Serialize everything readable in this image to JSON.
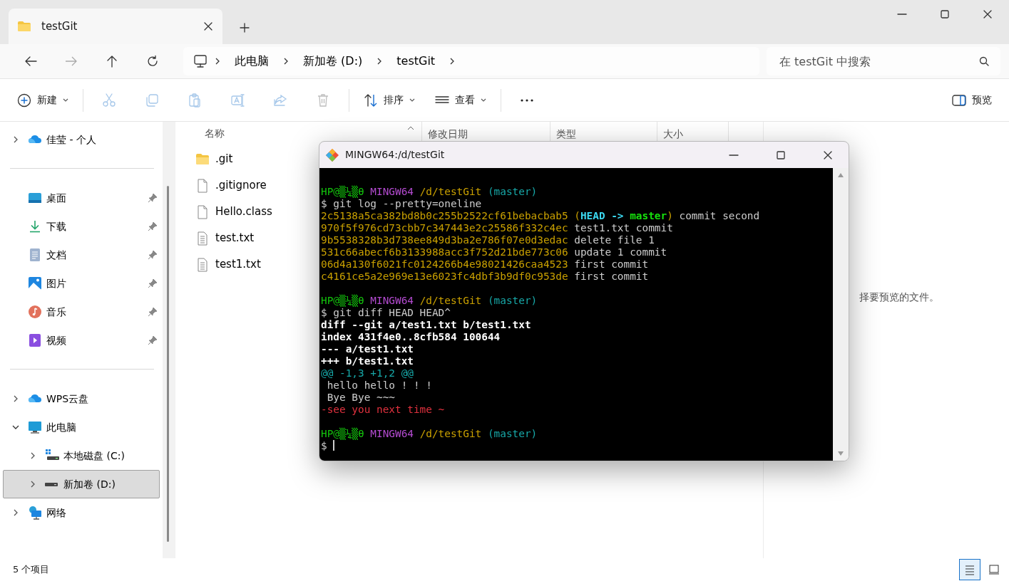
{
  "explorer": {
    "tabs": [
      {
        "title": "testGit",
        "selected": true
      }
    ],
    "address": {
      "crumbs": [
        "此电脑",
        "新加卷 (D:)",
        "testGit"
      ]
    },
    "search": {
      "placeholder": "在 testGit 中搜索"
    },
    "toolbar": [
      {
        "kind": "new",
        "label": "新建",
        "dropdown": true,
        "disabled": false
      },
      {
        "kind": "cut",
        "disabled": true
      },
      {
        "kind": "copy",
        "disabled": true
      },
      {
        "kind": "paste",
        "disabled": true
      },
      {
        "kind": "rename",
        "disabled": true
      },
      {
        "kind": "share",
        "disabled": true
      },
      {
        "kind": "delete",
        "disabled": true
      },
      {
        "kind": "sort",
        "label": "排序",
        "dropdown": true,
        "disabled": false
      },
      {
        "kind": "view",
        "label": "查看",
        "dropdown": true,
        "disabled": false
      },
      {
        "kind": "more"
      }
    ],
    "preview_button": {
      "label": "预览"
    },
    "sidebar": [
      [
        {
          "label": "佳莹 - 个人",
          "kind": "cloud",
          "expanded": false,
          "selected": false
        }
      ],
      [
        {
          "label": "桌面",
          "kind": "desktop",
          "pinned": true,
          "selected": false
        },
        {
          "label": "下载",
          "kind": "download",
          "pinned": true,
          "selected": false
        },
        {
          "label": "文档",
          "kind": "document",
          "pinned": true,
          "selected": false
        },
        {
          "label": "图片",
          "kind": "pictures",
          "pinned": true,
          "selected": false
        },
        {
          "label": "音乐",
          "kind": "music",
          "pinned": true,
          "selected": false
        },
        {
          "label": "视频",
          "kind": "video",
          "pinned": true,
          "selected": false
        }
      ],
      [
        {
          "label": "WPS云盘",
          "kind": "cloud",
          "expanded": false,
          "selected": false
        },
        {
          "label": "此电脑",
          "kind": "pc",
          "expanded": true,
          "selected": false,
          "children": [
            {
              "label": "本地磁盘 (C:)",
              "kind": "system-drive",
              "expanded": false,
              "selected": false
            },
            {
              "label": "新加卷 (D:)",
              "kind": "drive",
              "expanded": false,
              "selected": true
            }
          ]
        },
        {
          "label": "网络",
          "kind": "network",
          "expanded": false,
          "selected": false
        }
      ]
    ],
    "columns": [
      "名称",
      "修改日期",
      "类型",
      "大小"
    ],
    "files": [
      {
        "name": ".git",
        "kind": "folder"
      },
      {
        "name": ".gitignore",
        "kind": "file"
      },
      {
        "name": "Hello.class",
        "kind": "file"
      },
      {
        "name": "test.txt",
        "kind": "text"
      },
      {
        "name": "test1.txt",
        "kind": "text"
      }
    ],
    "preview_message": "择要预览的文件。",
    "status": "5 个项目",
    "view_modes": [
      {
        "kind": "details",
        "selected": true
      },
      {
        "kind": "tiles",
        "selected": false
      }
    ]
  },
  "terminal": {
    "title": "MINGW64:/d/testGit",
    "lines": [
      {
        "kind": "blank"
      },
      {
        "segments": [
          {
            "text": "HP@▒¼▒θ ",
            "kind": "user"
          },
          {
            "text": "MINGW64 ",
            "kind": "host"
          },
          {
            "text": "/d/testGit ",
            "kind": "path"
          },
          {
            "text": "(master)",
            "kind": "branch"
          }
        ]
      },
      {
        "segments": [
          {
            "text": "$ git log --pretty=oneline",
            "kind": "text"
          }
        ]
      },
      {
        "segments": [
          {
            "text": "2c5138a5ca382bd8b0c255b2522cf61bebacbab5 (",
            "kind": "hash"
          },
          {
            "text": "HEAD -> ",
            "kind": "head"
          },
          {
            "text": "master",
            "kind": "local"
          },
          {
            "text": ")",
            "kind": "hash"
          },
          {
            "text": " commit second",
            "kind": "text"
          }
        ]
      },
      {
        "segments": [
          {
            "text": "970f5f976cd73cbb7c347443e2c25586f332c4ec",
            "kind": "hash"
          },
          {
            "text": " test1.txt commit",
            "kind": "text"
          }
        ]
      },
      {
        "segments": [
          {
            "text": "9b5538328b3d738ee849d3ba2e786f07e0d3edac",
            "kind": "hash"
          },
          {
            "text": " delete file 1",
            "kind": "text"
          }
        ]
      },
      {
        "segments": [
          {
            "text": "531c66abecf6b3133988acc3f752d21bde773c06",
            "kind": "hash"
          },
          {
            "text": " update 1 commit",
            "kind": "text"
          }
        ]
      },
      {
        "segments": [
          {
            "text": "06d4a130f6021fc0124266b4e98021426caa4523",
            "kind": "hash"
          },
          {
            "text": " first commit",
            "kind": "text"
          }
        ]
      },
      {
        "segments": [
          {
            "text": "c4161ce5a2e969e13e6023fc4dbf3b9df0c953de",
            "kind": "hash"
          },
          {
            "text": " first commit",
            "kind": "text"
          }
        ]
      },
      {
        "kind": "blank"
      },
      {
        "segments": [
          {
            "text": "HP@▒¼▒θ ",
            "kind": "user"
          },
          {
            "text": "MINGW64 ",
            "kind": "host"
          },
          {
            "text": "/d/testGit ",
            "kind": "path"
          },
          {
            "text": "(master)",
            "kind": "branch"
          }
        ]
      },
      {
        "segments": [
          {
            "text": "$ git diff HEAD HEAD^",
            "kind": "text"
          }
        ]
      },
      {
        "segments": [
          {
            "text": "diff --git a/test1.txt b/test1.txt",
            "kind": "bold"
          }
        ]
      },
      {
        "segments": [
          {
            "text": "index 431f4e0..8cfb584 100644",
            "kind": "bold"
          }
        ]
      },
      {
        "segments": [
          {
            "text": "--- a/test1.txt",
            "kind": "bold"
          }
        ]
      },
      {
        "segments": [
          {
            "text": "+++ b/test1.txt",
            "kind": "bold"
          }
        ]
      },
      {
        "segments": [
          {
            "text": "@@ -1,3 +1,2 @@",
            "kind": "hunk"
          }
        ]
      },
      {
        "segments": [
          {
            "text": " hello hello ! ! !",
            "kind": "text"
          }
        ]
      },
      {
        "segments": [
          {
            "text": " Bye Bye ~~~",
            "kind": "text"
          }
        ]
      },
      {
        "segments": [
          {
            "text": "-see you next time ~",
            "kind": "removed"
          }
        ]
      },
      {
        "kind": "blank"
      },
      {
        "segments": [
          {
            "text": "HP@▒¼▒θ ",
            "kind": "user"
          },
          {
            "text": "MINGW64 ",
            "kind": "host"
          },
          {
            "text": "/d/testGit ",
            "kind": "path"
          },
          {
            "text": "(master)",
            "kind": "branch"
          }
        ]
      },
      {
        "segments": [
          {
            "text": "$ ",
            "kind": "text"
          }
        ],
        "cursor": true
      }
    ]
  }
}
